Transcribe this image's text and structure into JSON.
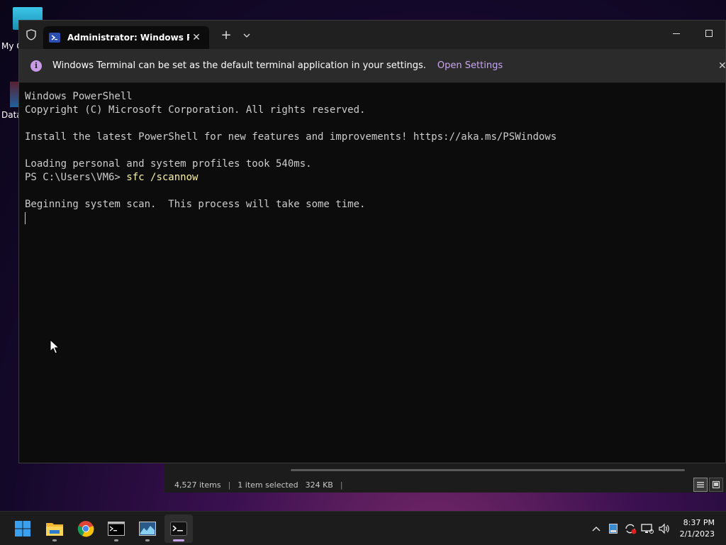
{
  "desktop": {
    "icons": [
      {
        "label": "My C"
      },
      {
        "label": "Data"
      }
    ]
  },
  "explorer": {
    "item_count": "4,527 items",
    "separator": "|",
    "selection": "1 item selected",
    "size": "324 KB"
  },
  "terminal": {
    "tab_title": "Administrator: Windows Powe",
    "new_tab_glyph": "+",
    "infobar": {
      "icon": "i",
      "message": "Windows Terminal can be set as the default terminal application in your settings.",
      "link": "Open Settings"
    },
    "console": {
      "line1": "Windows PowerShell",
      "line2": "Copyright (C) Microsoft Corporation. All rights reserved.",
      "line3": "Install the latest PowerShell for new features and improvements! https://aka.ms/PSWindows",
      "line4": "Loading personal and system profiles took 540ms.",
      "prompt": "PS C:\\Users\\VM6> ",
      "command": "sfc /scannow",
      "line6": "Beginning system scan.  This process will take some time."
    }
  },
  "taskbar": {
    "apps": [
      "start-icon",
      "file-explorer-icon",
      "chrome-icon",
      "command-prompt-icon",
      "resource-monitor-icon",
      "windows-terminal-icon"
    ],
    "clock": {
      "time": "8:37 PM",
      "date": "2/1/2023"
    }
  },
  "colors": {
    "accent": "#c8a6f0",
    "console_text": "#cccccc",
    "command_text": "#f9f1a5"
  }
}
